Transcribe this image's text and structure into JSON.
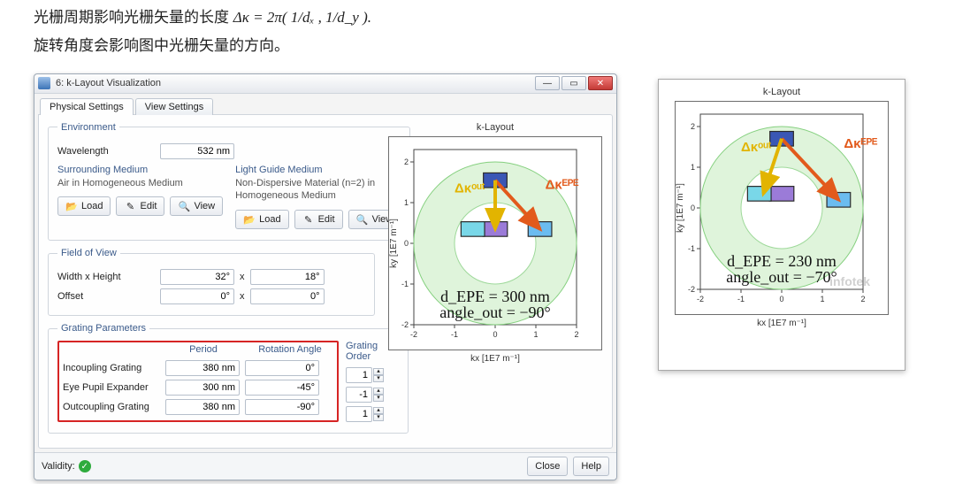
{
  "intro": {
    "line1_pre": "光栅周期影响光栅矢量的长度  ",
    "line1_formula": "Δκ = 2π( 1/dₓ , 1/d_y ).",
    "line2": "旋转角度会影响图中光栅矢量的方向。"
  },
  "dialog": {
    "title": "6: k-Layout Visualization",
    "tabs": {
      "physical": "Physical Settings",
      "view": "View Settings"
    },
    "env": {
      "legend": "Environment",
      "wavelength_label": "Wavelength",
      "wavelength_value": "532 nm",
      "surrounding_head": "Surrounding Medium",
      "surrounding_value": "Air in Homogeneous Medium",
      "lightguide_head": "Light Guide Medium",
      "lightguide_value": "Non-Dispersive Material (n=2) in Homogeneous Medium",
      "load": "Load",
      "edit": "Edit",
      "view": "View"
    },
    "fov": {
      "legend": "Field of View",
      "wh_label": "Width x Height",
      "wh_w": "32°",
      "wh_h": "18°",
      "offset_label": "Offset",
      "off_x": "0°",
      "off_y": "0°",
      "x": "x"
    },
    "gp": {
      "legend": "Grating Parameters",
      "period": "Period",
      "rotation": "Rotation Angle",
      "order": "Grating Order",
      "rows": [
        {
          "name": "Incoupling Grating",
          "period": "380 nm",
          "angle": "0°",
          "order": "1"
        },
        {
          "name": "Eye Pupil Expander",
          "period": "300 nm",
          "angle": "-45°",
          "order": "-1"
        },
        {
          "name": "Outcoupling Grating",
          "period": "380 nm",
          "angle": "-90°",
          "order": "1"
        }
      ]
    },
    "footer": {
      "validity": "Validity:",
      "close": "Close",
      "help": "Help"
    }
  },
  "chart_data": [
    {
      "type": "scatter",
      "title": "k-Layout",
      "xlabel": "kx [1E7 m⁻¹]",
      "ylabel": "ky [1E7 m⁻¹]",
      "xlim": [
        -2,
        2
      ],
      "ylim": [
        -2,
        2
      ],
      "rings": {
        "outer": 2.0,
        "inner": 1.0
      },
      "boxes": [
        {
          "name": "in",
          "cx": 0.0,
          "cy": 1.55,
          "w": 0.58,
          "h": 0.36,
          "fill": "#3a57b5"
        },
        {
          "name": "epe",
          "cx": 1.1,
          "cy": 0.35,
          "w": 0.58,
          "h": 0.36,
          "fill": "#6bbcf0"
        },
        {
          "name": "out_center",
          "cx": 0.0,
          "cy": 0.35,
          "w": 0.6,
          "h": 0.36,
          "fill": "#9b7bd8"
        },
        {
          "name": "out_left",
          "cx": -0.55,
          "cy": 0.35,
          "w": 0.58,
          "h": 0.36,
          "fill": "#79d7e8"
        }
      ],
      "arrows": [
        {
          "name": "epe",
          "from": [
            0.0,
            1.55
          ],
          "to": [
            1.1,
            0.35
          ],
          "color": "#e25a1c",
          "label": "Δκᴱᴾᴱ"
        },
        {
          "name": "out",
          "from": [
            0.0,
            1.55
          ],
          "to": [
            0.0,
            0.35
          ],
          "color": "#e2b400",
          "label": "Δκᵒᵘᵗ"
        }
      ],
      "annotations": [
        "d_EPE = 300 nm",
        "angle_out = −90°"
      ]
    },
    {
      "type": "scatter",
      "title": "k-Layout",
      "xlabel": "kx [1E7 m⁻¹]",
      "ylabel": "ky [1E7 m⁻¹]",
      "xlim": [
        -2,
        2
      ],
      "ylim": [
        -2,
        2
      ],
      "rings": {
        "outer": 2.0,
        "inner": 1.0
      },
      "boxes": [
        {
          "name": "in",
          "cx": 0.0,
          "cy": 1.7,
          "w": 0.58,
          "h": 0.36,
          "fill": "#3a57b5"
        },
        {
          "name": "epe",
          "cx": 1.4,
          "cy": 0.2,
          "w": 0.58,
          "h": 0.36,
          "fill": "#6bbcf0"
        },
        {
          "name": "out_center",
          "cx": 0.0,
          "cy": 0.35,
          "w": 0.6,
          "h": 0.36,
          "fill": "#9b7bd8"
        },
        {
          "name": "out_left",
          "cx": -0.55,
          "cy": 0.35,
          "w": 0.58,
          "h": 0.36,
          "fill": "#79d7e8"
        }
      ],
      "arrows": [
        {
          "name": "epe",
          "from": [
            0.0,
            1.7
          ],
          "to": [
            1.4,
            0.2
          ],
          "color": "#e25a1c",
          "label": "Δκᴱᴾᴱ"
        },
        {
          "name": "out",
          "from": [
            0.0,
            1.7
          ],
          "to": [
            -0.45,
            0.35
          ],
          "color": "#e2b400",
          "label": "Δκᵒᵘᵗ"
        }
      ],
      "annotations": [
        "d_EPE = 230 nm",
        "angle_out = −70°"
      ],
      "watermark": "infotek"
    }
  ]
}
